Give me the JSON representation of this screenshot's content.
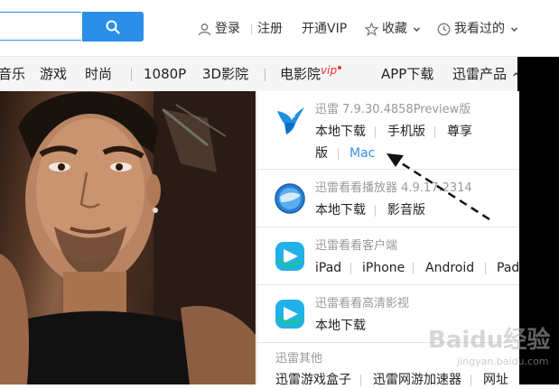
{
  "header": {
    "login": "登录",
    "register": "注册",
    "vip": "开通VIP",
    "favorites": "收藏",
    "history": "我看过的"
  },
  "nav": {
    "items": [
      "音乐",
      "游戏",
      "时尚",
      "1080P",
      "3D影院",
      "电影院",
      "APP下载",
      "迅雷产品"
    ],
    "vip_tag": "vip"
  },
  "dropdown": {
    "thunder": {
      "title": "迅雷 7.9.30.4858Preview版",
      "links": [
        "本地下载",
        "手机版",
        "尊享",
        "版",
        "Mac"
      ]
    },
    "player": {
      "title": "迅雷看看播放器 4.9.17.2314",
      "links": [
        "本地下载",
        "影音版"
      ]
    },
    "client": {
      "title": "迅雷看看客户端",
      "links": [
        "iPad",
        "iPhone",
        "Android",
        "Pad"
      ]
    },
    "hd": {
      "title": "迅雷看看高清影视",
      "links": [
        "本地下载"
      ]
    },
    "others": {
      "title": "迅雷其他",
      "links": [
        "迅雷游戏盒子",
        "迅雷网游加速器",
        "网址"
      ]
    }
  },
  "watermark": {
    "brand": "Baidu经验",
    "url": "jingyan.baidu.com"
  },
  "colors": {
    "accent": "#2b8ee8",
    "link_blue": "#3a8ee6",
    "vip_red": "#e33333"
  }
}
